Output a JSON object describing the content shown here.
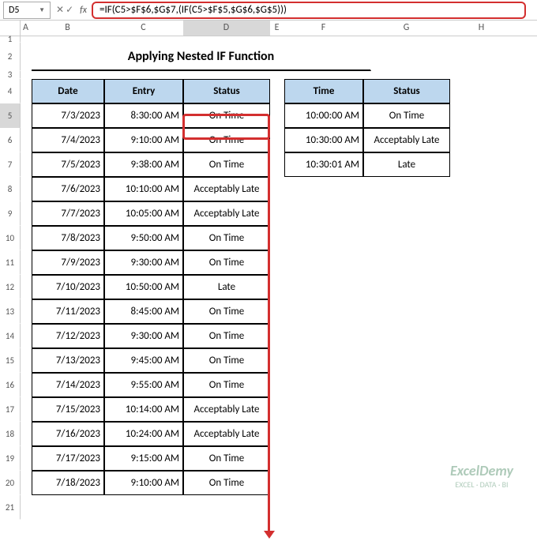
{
  "name_box": "D5",
  "formula": "=IF(C5>$F$6,$G$7,(IF(C5>$F$5,$G$6,$G$5)))",
  "title": "Applying Nested IF Function",
  "columns": [
    "A",
    "B",
    "C",
    "D",
    "E",
    "F",
    "G",
    "H"
  ],
  "main_headers": {
    "date": "Date",
    "entry": "Entry",
    "status": "Status"
  },
  "lookup_headers": {
    "time": "Time",
    "status": "Status"
  },
  "rows": [
    {
      "n": 5,
      "date": "7/3/2023",
      "entry": "8:30:00 AM",
      "status": "On Time"
    },
    {
      "n": 6,
      "date": "7/4/2023",
      "entry": "9:10:00 AM",
      "status": "On Time"
    },
    {
      "n": 7,
      "date": "7/5/2023",
      "entry": "9:38:00 AM",
      "status": "On Time"
    },
    {
      "n": 8,
      "date": "7/6/2023",
      "entry": "10:10:00 AM",
      "status": "Acceptably Late"
    },
    {
      "n": 9,
      "date": "7/7/2023",
      "entry": "10:05:00 AM",
      "status": "Acceptably Late"
    },
    {
      "n": 10,
      "date": "7/8/2023",
      "entry": "9:50:00 AM",
      "status": "On Time"
    },
    {
      "n": 11,
      "date": "7/9/2023",
      "entry": "9:30:00 AM",
      "status": "On Time"
    },
    {
      "n": 12,
      "date": "7/10/2023",
      "entry": "10:50:00 AM",
      "status": "Late"
    },
    {
      "n": 13,
      "date": "7/11/2023",
      "entry": "8:45:00 AM",
      "status": "On Time"
    },
    {
      "n": 14,
      "date": "7/12/2023",
      "entry": "9:30:00 AM",
      "status": "On Time"
    },
    {
      "n": 15,
      "date": "7/13/2023",
      "entry": "9:45:00 AM",
      "status": "On Time"
    },
    {
      "n": 16,
      "date": "7/14/2023",
      "entry": "9:55:00 AM",
      "status": "On Time"
    },
    {
      "n": 17,
      "date": "7/15/2023",
      "entry": "10:14:00 AM",
      "status": "Acceptably Late"
    },
    {
      "n": 18,
      "date": "7/16/2023",
      "entry": "10:24:00 AM",
      "status": "Acceptably Late"
    },
    {
      "n": 19,
      "date": "7/17/2023",
      "entry": "9:15:00 AM",
      "status": "On Time"
    },
    {
      "n": 20,
      "date": "7/18/2023",
      "entry": "9:10:00 AM",
      "status": "On Time"
    }
  ],
  "lookup": [
    {
      "time": "10:00:00 AM",
      "status": "On Time"
    },
    {
      "time": "10:30:00 AM",
      "status": "Acceptably Late"
    },
    {
      "time": "10:30:01 AM",
      "status": "Late"
    }
  ],
  "watermark": {
    "big": "ExcelDemy",
    "small": "EXCEL · DATA · BI"
  },
  "fx": "fx"
}
